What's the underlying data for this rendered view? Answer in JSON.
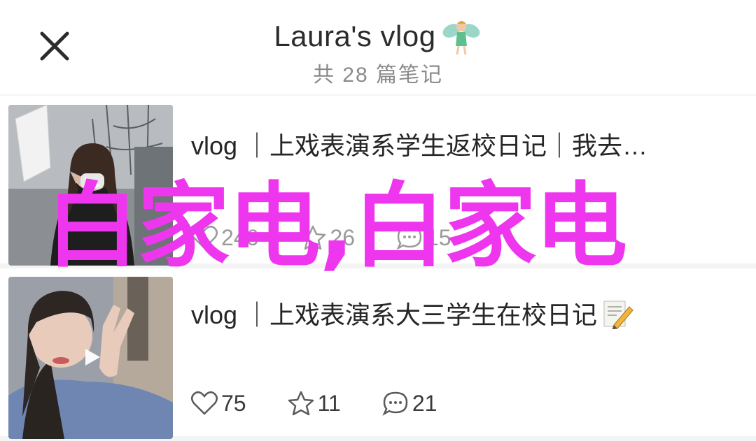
{
  "header": {
    "title": "Laura's vlog",
    "title_emoji_icon": "fairy-icon",
    "subtitle": "共 28 篇笔记",
    "close_icon": "close-icon"
  },
  "notes": [
    {
      "title": "vlog ｜上戏表演系学生返校日记｜我去…",
      "likes": "246",
      "favorites": "26",
      "comments": "15",
      "has_video": true
    },
    {
      "title": "vlog ｜上戏表演系大三学生在校日记",
      "title_emoji_icon": "memo-icon",
      "likes": "75",
      "favorites": "11",
      "comments": "21",
      "has_video": true
    }
  ],
  "watermark": "白家电,白家电",
  "colors": {
    "watermark": "#ee36ee",
    "background": "#f4f4f4",
    "text": "#262626",
    "muted": "#8a8a8a"
  }
}
